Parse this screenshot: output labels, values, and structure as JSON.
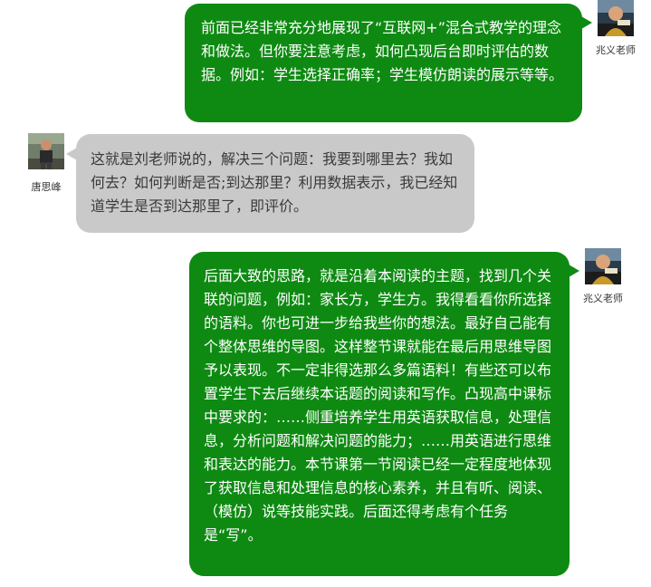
{
  "messages": [
    {
      "sender": "兆义老师",
      "text": "前面已经非常充分地展现了“互联网+”混合式教学的理念和做法。但你要注意考虑，如何凸现后台即时评估的数据。例如：学生选择正确率；学生模仿朗读的展示等等。"
    },
    {
      "sender": "唐思峰",
      "text": "这就是刘老师说的，解决三个问题：我要到哪里去？我如何去？如何判断是否;到达那里？利用数据表示，我已经知道学生是否到达那里了，即评价。"
    },
    {
      "sender": "兆义老师",
      "text": "后面大致的思路，就是沿着本阅读的主题，找到几个关联的问题，例如：家长方，学生方。我得看看你所选择的语料。你也可进一步给我些你的想法。最好自己能有个整体思维的导图。这样整节课就能在最后用思维导图予以表现。不一定非得选那么多篇语料！有些还可以布置学生下去后继续本话题的阅读和写作。凸现高中课标中要求的：……侧重培养学生用英语获取信息，处理信息，分析问题和解决问题的能力；……用英语进行思维和表达的能力。本节课第一节阅读已经一定程度地体现了获取信息和处理信息的核心素养，并且有听、阅读、（模仿）说等技能实践。后面还得考虑有个任务是“写”。"
    }
  ],
  "colors": {
    "teacher_bubble": "#0e8a12",
    "student_bubble": "#c9c9c9"
  }
}
